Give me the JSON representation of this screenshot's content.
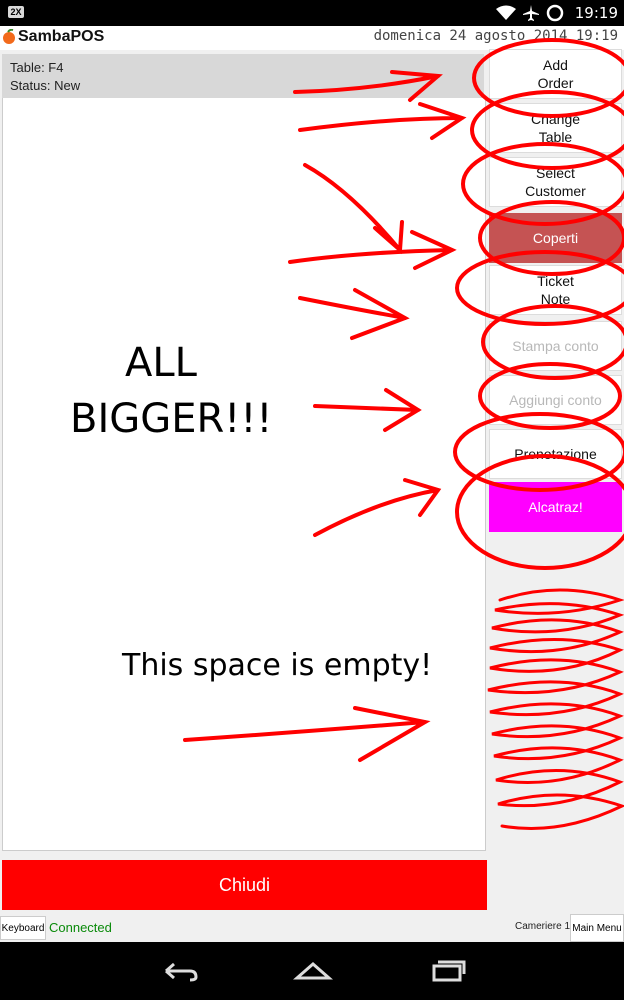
{
  "statusbar": {
    "badge": "2X",
    "time": "19:19",
    "icons": [
      "wifi-icon",
      "airplane-icon",
      "sync-icon"
    ]
  },
  "header": {
    "app_name": "SambaPOS",
    "date": "domenica 24 agosto 2014 19:19"
  },
  "ticket": {
    "table": "Table: F4",
    "status": "Status: New"
  },
  "side_buttons": [
    {
      "label": "Add\nOrder",
      "enabled": true
    },
    {
      "label": "Change\nTable",
      "enabled": true
    },
    {
      "label": "Select\nCustomer",
      "enabled": true
    },
    {
      "label": "Coperti",
      "enabled": true,
      "color": "#c55353"
    },
    {
      "label": "Ticket\nNote",
      "enabled": true
    },
    {
      "label": "Stampa conto",
      "enabled": false
    },
    {
      "label": "Aggiungi conto",
      "enabled": false
    },
    {
      "label": "Prenotazione",
      "enabled": true
    },
    {
      "label": "Alcatraz!",
      "enabled": true,
      "color": "#ff00ff"
    }
  ],
  "close_button": {
    "label": "Chiudi",
    "color": "#ff0000"
  },
  "footer": {
    "keyboard": "Keyboard",
    "connection": "Connected",
    "user": "Cameriere 1",
    "main_menu": "Main Menu"
  },
  "annotations": {
    "bigger_line1": "ALL",
    "bigger_line2": "BIGGER!!!",
    "empty_note": "This space is empty!"
  },
  "colors": {
    "accent": "#ff0000",
    "annotation": "#ff0000"
  }
}
